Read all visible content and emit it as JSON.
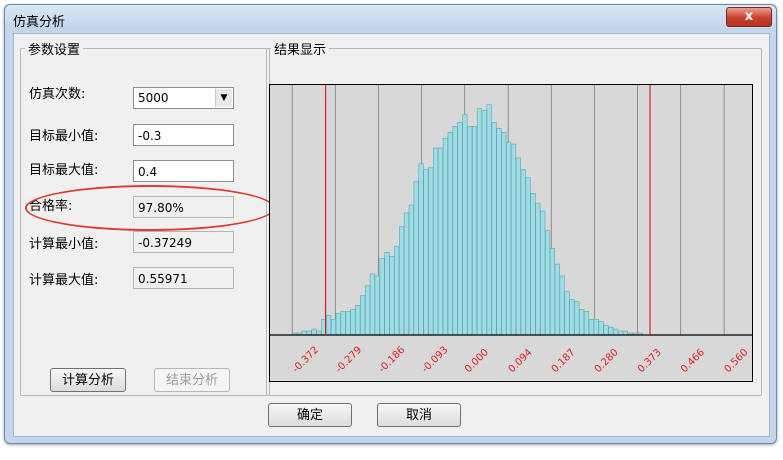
{
  "window": {
    "title": "仿真分析",
    "close_label": "x"
  },
  "params": {
    "legend": "参数设置",
    "sim_count_label": "仿真次数:",
    "sim_count_value": "5000",
    "target_min_label": "目标最小值:",
    "target_min_value": "-0.3",
    "target_max_label": "目标最大值:",
    "target_max_value": "0.4",
    "pass_rate_label": "合格率:",
    "pass_rate_value": "97.80%",
    "calc_min_label": "计算最小值:",
    "calc_min_value": "-0.37249",
    "calc_max_label": "计算最大值:",
    "calc_max_value": "0.55971",
    "calc_button": "计算分析",
    "end_button": "结束分析"
  },
  "results": {
    "legend": "结果显示"
  },
  "footer": {
    "ok_button": "确定",
    "cancel_button": "取消"
  },
  "chart_data": {
    "type": "bar",
    "xlim": [
      -0.42,
      0.62
    ],
    "ylim": [
      0,
      125
    ],
    "x_ticks": [
      -0.372,
      -0.279,
      -0.186,
      -0.093,
      0.0,
      0.094,
      0.187,
      0.28,
      0.373,
      0.466,
      0.56
    ],
    "x_tick_labels": [
      "-0.372",
      "-0.279",
      "-0.186",
      "-0.093",
      "0.000",
      "0.094",
      "0.187",
      "0.280",
      "0.373",
      "0.466",
      "0.560"
    ],
    "target_lines": [
      -0.3,
      0.4
    ],
    "grid": true,
    "bin_start": -0.372,
    "bin_width": 0.0105,
    "values": [
      1,
      1,
      2,
      2,
      3,
      2,
      8,
      10,
      8,
      11,
      12,
      12,
      13,
      15,
      20,
      25,
      31,
      30,
      39,
      42,
      40,
      45,
      55,
      62,
      66,
      78,
      87,
      84,
      85,
      95,
      95,
      100,
      103,
      106,
      108,
      112,
      106,
      106,
      115,
      114,
      117,
      108,
      105,
      103,
      98,
      97,
      90,
      84,
      80,
      72,
      67,
      63,
      53,
      44,
      36,
      30,
      22,
      18,
      17,
      13,
      12,
      8,
      8,
      7,
      5,
      4,
      3,
      2,
      2,
      1,
      1,
      1
    ]
  },
  "colors": {
    "bar_fill": "#9fdce4",
    "bar_edge": "#5aa7b2",
    "target_line": "#e02020",
    "tick_label": "#e02020",
    "annotation": "#e03a30"
  }
}
